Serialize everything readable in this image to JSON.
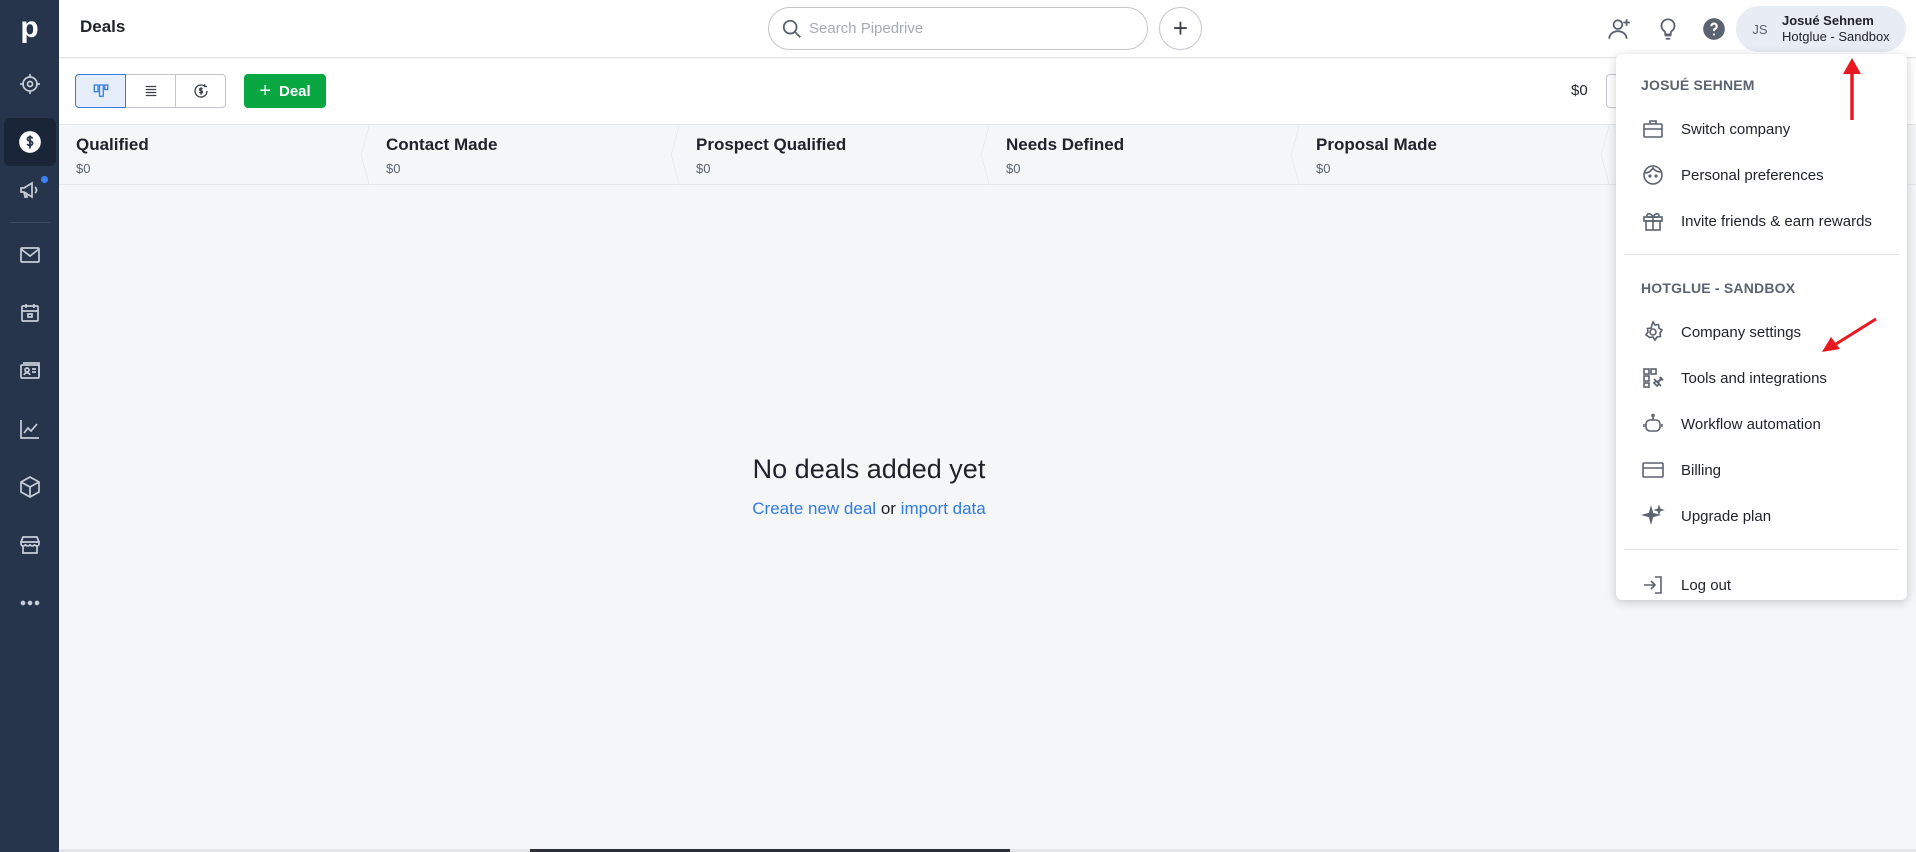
{
  "app": {
    "logo": "p"
  },
  "sidebar": {
    "items": [
      {
        "icon": "target-icon",
        "active": false
      },
      {
        "icon": "dollar-icon",
        "active": true
      },
      {
        "icon": "megaphone-icon",
        "active": false
      },
      {
        "icon": "mail-icon",
        "active": false
      },
      {
        "icon": "calendar-icon",
        "active": false
      },
      {
        "icon": "contacts-icon",
        "active": false
      },
      {
        "icon": "chart-icon",
        "active": false
      },
      {
        "icon": "box-icon",
        "active": false
      },
      {
        "icon": "store-icon",
        "active": false
      },
      {
        "icon": "more-icon",
        "active": false
      }
    ]
  },
  "header": {
    "title": "Deals",
    "search_placeholder": "Search Pipedrive",
    "add_label": "+",
    "user": {
      "initials": "JS",
      "name": "Josué Sehnem",
      "company": "Hotglue - Sandbox"
    }
  },
  "toolbar": {
    "deal_button": "Deal",
    "total": "$0"
  },
  "stages": [
    {
      "name": "Qualified",
      "value": "$0"
    },
    {
      "name": "Contact Made",
      "value": "$0"
    },
    {
      "name": "Prospect Qualified",
      "value": "$0"
    },
    {
      "name": "Needs Defined",
      "value": "$0"
    },
    {
      "name": "Proposal Made",
      "value": ""
    }
  ],
  "empty_state": {
    "title": "No deals added yet",
    "create_link": "Create new deal",
    "or_text": "or",
    "import_link": "import data"
  },
  "dropdown": {
    "section1_header": "JOSUÉ SEHNEM",
    "section1_items": [
      {
        "label": "Switch company",
        "icon": "briefcase-icon"
      },
      {
        "label": "Personal preferences",
        "icon": "face-icon"
      },
      {
        "label": "Invite friends & earn rewards",
        "icon": "gift-icon"
      }
    ],
    "section2_header": "HOTGLUE - SANDBOX",
    "section2_items": [
      {
        "label": "Company settings",
        "icon": "gear-icon"
      },
      {
        "label": "Tools and integrations",
        "icon": "tools-icon"
      },
      {
        "label": "Workflow automation",
        "icon": "robot-icon"
      },
      {
        "label": "Billing",
        "icon": "credit-card-icon"
      },
      {
        "label": "Upgrade plan",
        "icon": "sparkle-icon"
      }
    ],
    "logout": "Log out"
  },
  "colors": {
    "accent": "#317ae2",
    "deal_button": "#08a742",
    "sidebar": "#26354b",
    "annotation": "#e8191f"
  }
}
